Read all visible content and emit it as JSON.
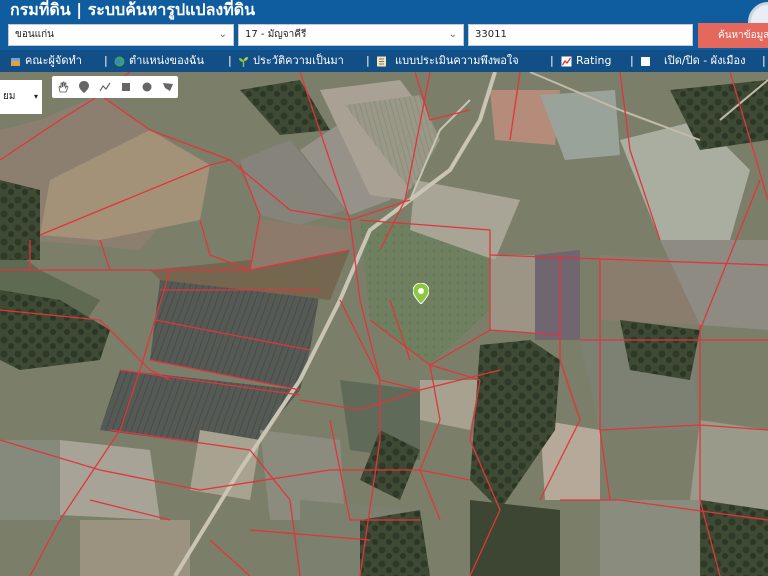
{
  "header": {
    "title": "กรมที่ดิน | ระบบค้นหารูปแปลงที่ดิน"
  },
  "search": {
    "province": "ขอนแก่น",
    "district": "17 - มัญจาคีรี",
    "parcel_no": "33011",
    "button": "ค้นหาข้อมูล"
  },
  "menu": {
    "items": [
      {
        "label": "คณะผู้จัดทำ",
        "icon": "team-icon"
      },
      {
        "label": "ตำแหน่งของฉัน",
        "icon": "globe-icon"
      },
      {
        "label": "ประวัติความเป็นมา",
        "icon": "sprout-icon"
      },
      {
        "label": "แบบประเมินความพึงพอใจ",
        "icon": "form-icon"
      },
      {
        "label": "Rating",
        "icon": "chart-icon"
      },
      {
        "label": "เปิด/ปิด - ผังเมือง",
        "icon": "checkbox-icon"
      }
    ]
  },
  "map": {
    "basemap_label": "ยม",
    "tools": [
      "hand-icon",
      "pin-icon",
      "line-icon",
      "square-icon",
      "circle-icon",
      "polygon-icon"
    ],
    "parcel_line_color": "#e0353c",
    "pin_color": "#8dc63f"
  },
  "colors": {
    "header_bg": "#0f5d9e",
    "menubar_bg": "#124f86",
    "search_button": "#e5685d"
  }
}
